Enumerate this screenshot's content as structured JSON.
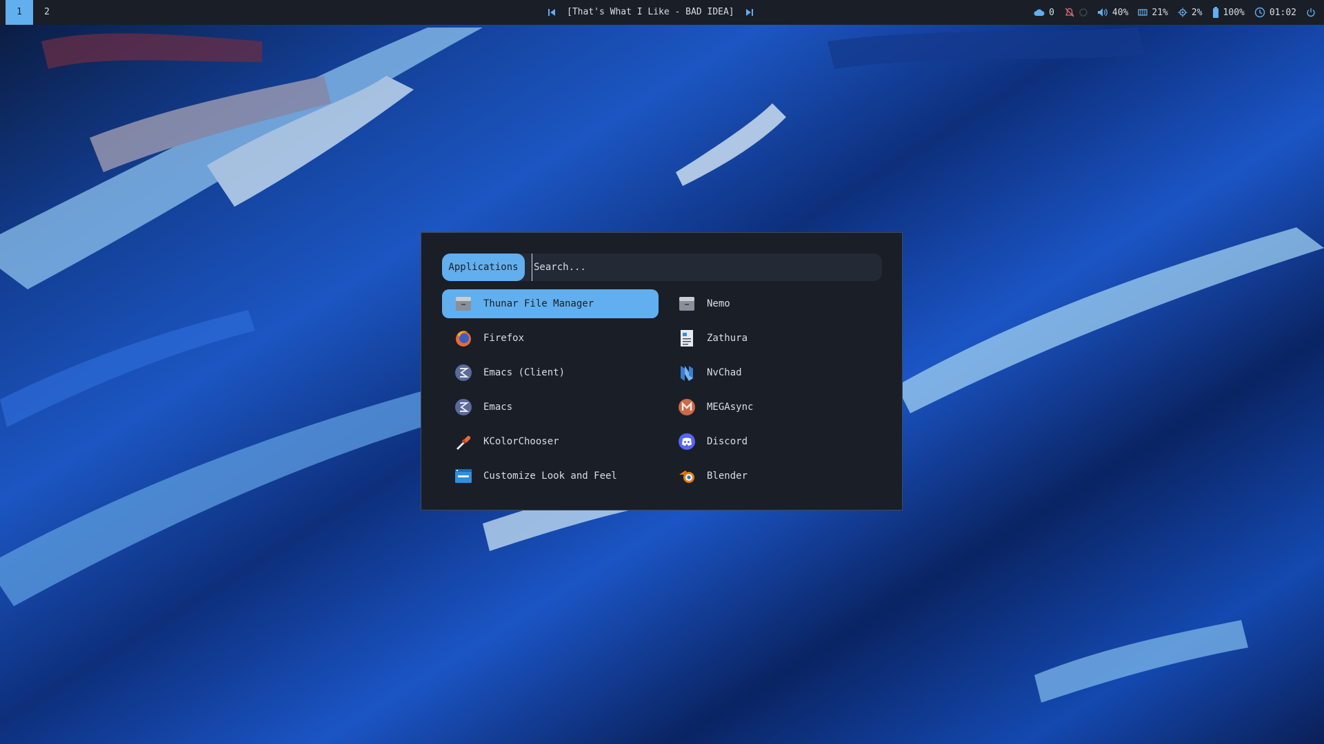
{
  "topbar": {
    "workspaces": [
      {
        "label": "1",
        "active": true
      },
      {
        "label": "2",
        "active": false
      }
    ],
    "media": {
      "title": "[That's What I Like - BAD IDEA]"
    },
    "status": {
      "cloud": "0",
      "volume": "40%",
      "memory": "21%",
      "cpu": "2%",
      "battery": "100%",
      "clock": "01:02"
    },
    "accent_color": "#61afef",
    "bar_bg": "#1a1e27"
  },
  "launcher": {
    "mode_label": "Applications",
    "search": {
      "placeholder": "Search...",
      "value": ""
    },
    "apps": [
      {
        "label": "Thunar File Manager",
        "icon": "file-manager-icon",
        "selected": true
      },
      {
        "label": "Nemo",
        "icon": "file-manager-icon",
        "selected": false
      },
      {
        "label": "Firefox",
        "icon": "firefox-icon",
        "selected": false
      },
      {
        "label": "Zathura",
        "icon": "document-viewer-icon",
        "selected": false
      },
      {
        "label": "Emacs (Client)",
        "icon": "emacs-icon",
        "selected": false
      },
      {
        "label": "NvChad",
        "icon": "neovim-icon",
        "selected": false
      },
      {
        "label": "Emacs",
        "icon": "emacs-icon",
        "selected": false
      },
      {
        "label": "MEGAsync",
        "icon": "mega-icon",
        "selected": false
      },
      {
        "label": "KColorChooser",
        "icon": "color-picker-icon",
        "selected": false
      },
      {
        "label": "Discord",
        "icon": "discord-icon",
        "selected": false
      },
      {
        "label": "Customize Look and Feel",
        "icon": "appearance-settings-icon",
        "selected": false
      },
      {
        "label": "Blender",
        "icon": "blender-icon",
        "selected": false
      }
    ],
    "selected_color": "#61afef",
    "panel_bg": "#1a1e27"
  }
}
